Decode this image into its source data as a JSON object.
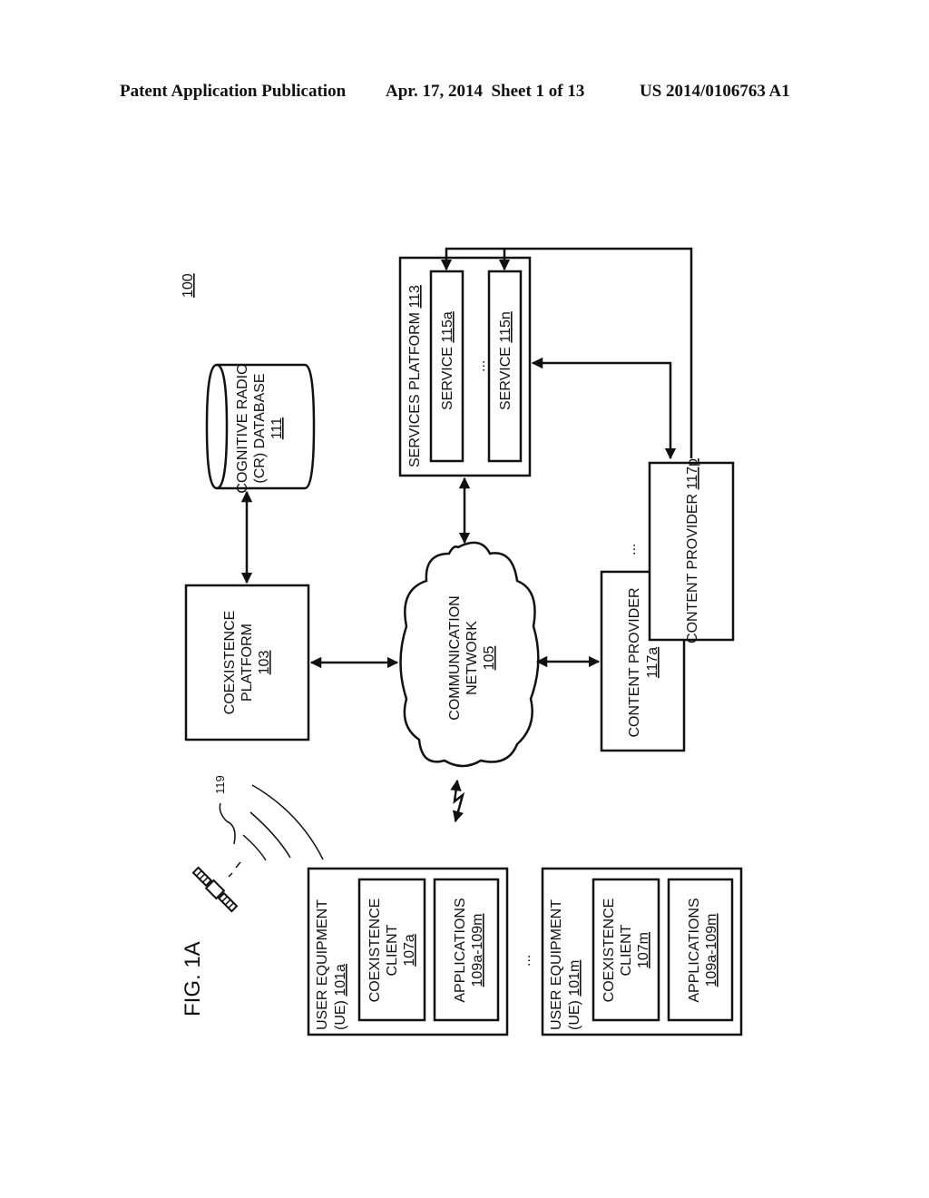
{
  "header": {
    "publication": "Patent Application Publication",
    "date_sheet": "Apr. 17, 2014  Sheet 1 of 13",
    "patent_number": "US 2014/0106763 A1"
  },
  "figure": {
    "label": "FIG. 1A",
    "system_ref": "100",
    "satellite_signal_ref": "119",
    "coexistence_platform": {
      "line1": "COEXISTENCE",
      "line2": "PLATFORM",
      "ref": "103"
    },
    "cr_database": {
      "line1": "COGNITIVE RADIO",
      "line2": "(CR) DATABASE",
      "ref": "111"
    },
    "communication_network": {
      "line1": "COMMUNICATION",
      "line2": "NETWORK",
      "ref": "105"
    },
    "services_platform": {
      "label": "SERVICES PLATFORM",
      "ref": "113",
      "services": [
        {
          "label": "SERVICE",
          "ref": "115a"
        },
        {
          "label": "SERVICE",
          "ref": "115n"
        }
      ],
      "ellipsis": "..."
    },
    "content_providers": [
      {
        "label": "CONTENT PROVIDER",
        "ref": "117a"
      },
      {
        "label": "CONTENT PROVIDER",
        "ref": "117p"
      }
    ],
    "content_provider_ellipsis": "...",
    "user_equipment": [
      {
        "line1": "USER EQUIPMENT",
        "line2": "(UE)",
        "ref": "101a",
        "client": {
          "line1": "COEXISTENCE",
          "line2": "CLIENT",
          "ref": "107a"
        },
        "apps": {
          "label": "APPLICATIONS",
          "ref": "109a-109m"
        }
      },
      {
        "line1": "USER EQUIPMENT",
        "line2": "(UE)",
        "ref": "101m",
        "client": {
          "line1": "COEXISTENCE",
          "line2": "CLIENT",
          "ref": "107m"
        },
        "apps": {
          "label": "APPLICATIONS",
          "ref": "109a-109m"
        }
      }
    ],
    "ue_ellipsis": "..."
  }
}
